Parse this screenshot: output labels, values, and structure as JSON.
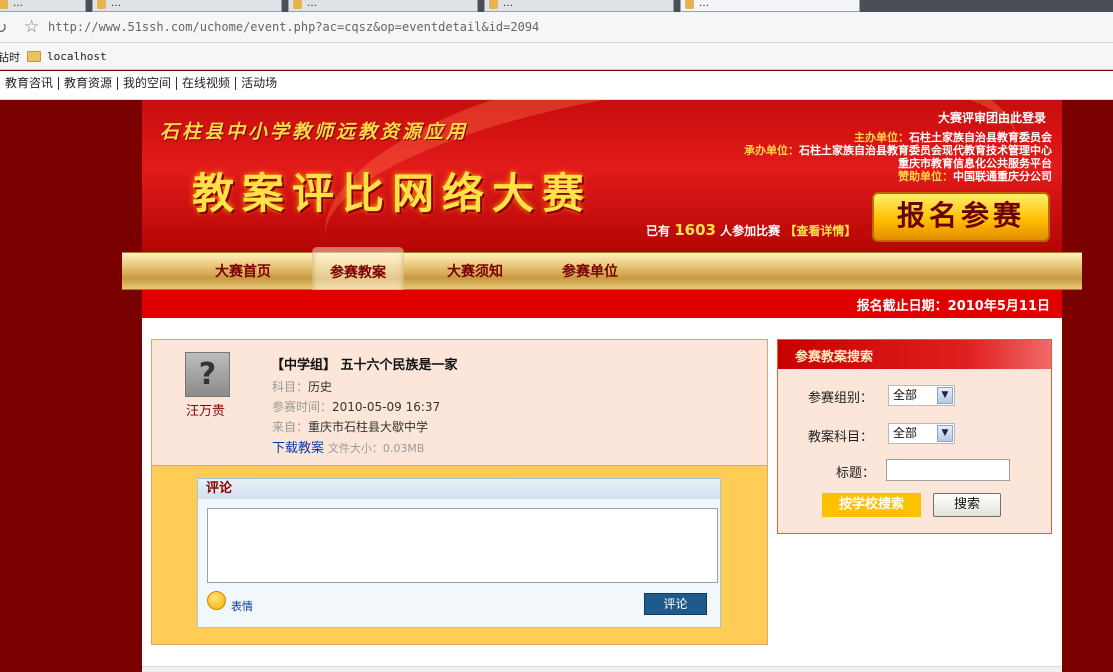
{
  "browser": {
    "tabs": [
      {
        "label": "…"
      },
      {
        "label": "…"
      },
      {
        "label": "…"
      },
      {
        "label": "…"
      },
      {
        "label": "…"
      }
    ],
    "url": "http://www.51ssh.com/uchome/event.php?ac=cqsz&op=eventdetail&id=2094",
    "bookmark_left": "钻时",
    "bookmark_folder": "localhost"
  },
  "topnav": [
    "教育咨讯",
    "教育资源",
    "我的空间",
    "在线视频",
    "活动场"
  ],
  "banner": {
    "subtitle": "石柱县中小学教师远教资源应用",
    "title": "教案评比网络大赛",
    "login": "大赛评审团由此登录",
    "orgs": [
      {
        "k": "主办单位：",
        "v": "石柱土家族自治县教育委员会"
      },
      {
        "k": "承办单位：",
        "v": "石柱土家族自治县教育委员会现代教育技术管理中心"
      },
      {
        "k": "",
        "v": "重庆市教育信息化公共服务平台"
      },
      {
        "k": "赞助单位：",
        "v": "中国联通重庆分公司"
      }
    ],
    "count_prefix": "已有",
    "count": "1603",
    "count_suffix": "人参加比赛",
    "details_link": "【查看详情】",
    "signup": "报名参赛"
  },
  "menu": [
    "大赛首页",
    "参赛教案",
    "大赛须知",
    "参赛单位"
  ],
  "deadline": "报名截止日期：2010年5月11日",
  "plan": {
    "author": "汪万贵",
    "title": "【中学组】 五十六个民族是一家",
    "subject_label": "科目：",
    "subject": "历史",
    "time_label": "参赛时间：",
    "time": "2010-05-09 16:37",
    "source_label": "来自：",
    "source": "重庆市石柱县大歇中学",
    "download": "下载教案",
    "filesize": "文件大小：0.03MB"
  },
  "comment": {
    "header": "评论",
    "emoji_label": "表情",
    "submit": "评论"
  },
  "search": {
    "header": "参赛教案搜索",
    "group_label": "参赛组别：",
    "group_value": "全部",
    "subject_label": "教案科目：",
    "subject_value": "全部",
    "title_label": "标题：",
    "school_search": "按学校搜索",
    "search": "搜索"
  }
}
